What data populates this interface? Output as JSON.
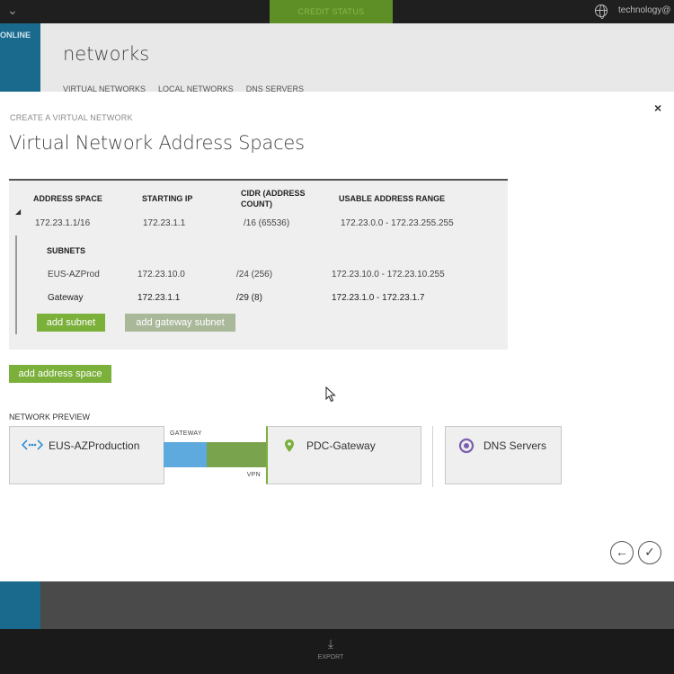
{
  "portal": {
    "credit_status": "CREDIT STATUS",
    "account": "technology@",
    "online_label": "ONLINE",
    "networks_title": "networks",
    "tabs": [
      "VIRTUAL NETWORKS",
      "LOCAL NETWORKS",
      "DNS SERVERS"
    ],
    "export_label": "EXPORT"
  },
  "dialog": {
    "close_label": "×",
    "breadcrumb": "CREATE A VIRTUAL NETWORK",
    "title": "Virtual Network Address Spaces",
    "headers": {
      "address_space": "ADDRESS SPACE",
      "starting_ip": "STARTING IP",
      "cidr_line1": "CIDR (ADDRESS",
      "cidr_line2": "COUNT)",
      "usable_range": "USABLE ADDRESS RANGE"
    },
    "address_space_row": {
      "address_space": "172.23.1.1/16",
      "starting_ip": "172.23.1.1",
      "cidr": "/16 (65536)",
      "usable_range": "172.23.0.0 - 172.23.255.255"
    },
    "subnets_heading": "SUBNETS",
    "subnets": [
      {
        "name": "EUS-AZProd",
        "starting_ip": "172.23.10.0",
        "cidr": "/24 (256)",
        "usable_range": "172.23.10.0 - 172.23.10.255"
      },
      {
        "name": "Gateway",
        "starting_ip": "172.23.1.1",
        "cidr": "/29 (8)",
        "usable_range": "172.23.1.0 - 172.23.1.7"
      }
    ],
    "add_subnet_label": "add subnet",
    "add_gateway_subnet_label": "add gateway subnet",
    "add_address_space_label": "add address space",
    "network_preview_label": "NETWORK PREVIEW",
    "preview": {
      "vnet_name": "EUS-AZProduction",
      "gateway_label": "GATEWAY",
      "vpn_label": "VPN",
      "local_name": "PDC-Gateway",
      "dns_label": "DNS Servers"
    },
    "back_label": "←",
    "finish_label": "✓"
  },
  "colors": {
    "accent_green": "#7bb03b",
    "gateway_blue": "#5ea9dd",
    "portal_blue": "#1a6a8d",
    "dns_purple": "#7b5fb0"
  }
}
